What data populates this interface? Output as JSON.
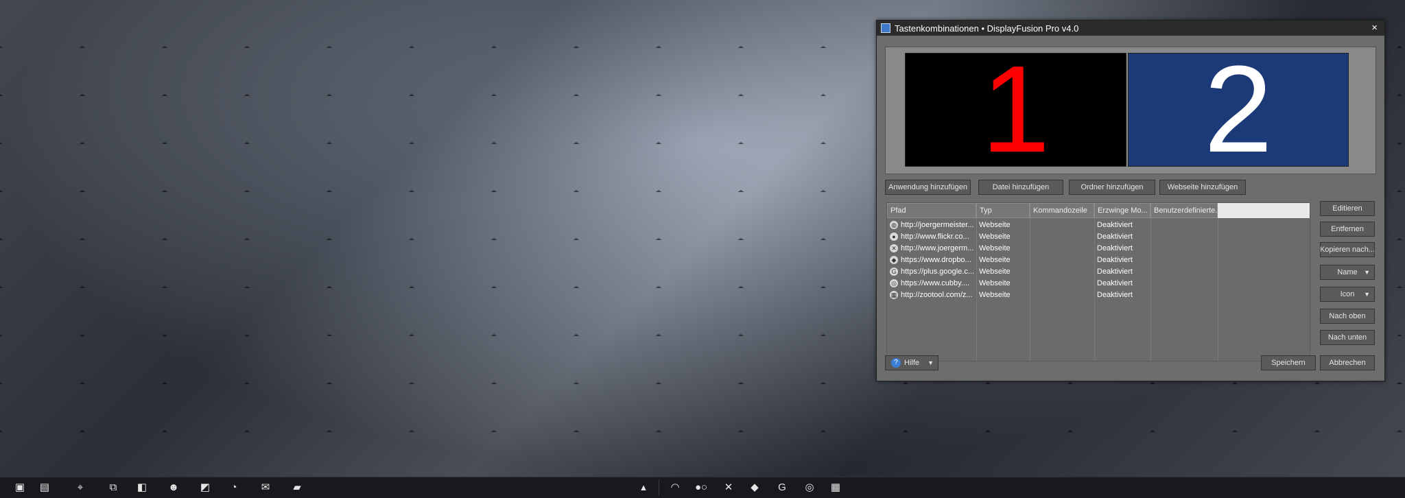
{
  "window": {
    "title": "Tastenkombinationen • DisplayFusion Pro v4.0",
    "close": "×"
  },
  "monitors": [
    {
      "label": "1",
      "color": "#ff0000",
      "background": "#000000"
    },
    {
      "label": "2",
      "color": "#ffffff",
      "background": "#1c3a78"
    }
  ],
  "add_buttons": [
    "Anwendung hinzufügen",
    "Datei hinzufügen",
    "Ordner hinzufügen",
    "Webseite hinzufügen"
  ],
  "columns": [
    "Pfad",
    "Typ",
    "Kommandozeile",
    "Erzwinge Mo...",
    "Benutzerdefinierte..."
  ],
  "rows": [
    {
      "icon": "globe-icon",
      "glyph": "◍",
      "path": "http://joergermeister...",
      "type": "Webseite",
      "force": "Deaktiviert"
    },
    {
      "icon": "flickr-icon",
      "glyph": "●",
      "path": "http://www.flickr.co...",
      "type": "Webseite",
      "force": "Deaktiviert"
    },
    {
      "icon": "tools-icon",
      "glyph": "✕",
      "path": "http://www.joergerm...",
      "type": "Webseite",
      "force": "Deaktiviert"
    },
    {
      "icon": "dropbox-icon",
      "glyph": "◆",
      "path": "https://www.dropbo...",
      "type": "Webseite",
      "force": "Deaktiviert"
    },
    {
      "icon": "google-plus-icon",
      "glyph": "G",
      "path": "https://plus.google.c...",
      "type": "Webseite",
      "force": "Deaktiviert"
    },
    {
      "icon": "cubby-icon",
      "glyph": "◎",
      "path": "https://www.cubby....",
      "type": "Webseite",
      "force": "Deaktiviert"
    },
    {
      "icon": "zootool-icon",
      "glyph": "▦",
      "path": "http://zootool.com/z...",
      "type": "Webseite",
      "force": "Deaktiviert"
    }
  ],
  "side_buttons": {
    "edit": "Editieren",
    "remove": "Entfernen",
    "copy": "Kopieren nach...",
    "name": "Name",
    "icon": "Icon",
    "up": "Nach oben",
    "down": "Nach unten"
  },
  "help": {
    "icon": "?",
    "label": "Hilfe"
  },
  "footer": {
    "save": "Speichern",
    "cancel": "Abbrechen"
  },
  "taskbar": {
    "left": [
      {
        "name": "taskbar-app-1-icon",
        "glyph": "▣"
      },
      {
        "name": "taskbar-app-2-icon",
        "glyph": "▤"
      },
      {
        "name": "taskbar-crosshair-icon",
        "glyph": "⌖"
      },
      {
        "name": "taskbar-windows-icon",
        "glyph": "⧉"
      },
      {
        "name": "taskbar-notes-icon",
        "glyph": "◧"
      },
      {
        "name": "taskbar-people-icon",
        "glyph": "☻"
      },
      {
        "name": "taskbar-displayfusion-icon",
        "glyph": "◩"
      },
      {
        "name": "taskbar-disc-icon",
        "glyph": "◔"
      },
      {
        "name": "taskbar-mail-icon",
        "glyph": "✉"
      },
      {
        "name": "taskbar-clapper-icon",
        "glyph": "▰"
      }
    ],
    "right": [
      {
        "name": "taskbar-expand-icon",
        "glyph": "▴"
      },
      {
        "name": "taskbar-wifi-icon",
        "glyph": "◠"
      },
      {
        "name": "taskbar-flickr-icon",
        "glyph": "●○"
      },
      {
        "name": "taskbar-tools-icon",
        "glyph": "✕"
      },
      {
        "name": "taskbar-dropbox-icon",
        "glyph": "◆"
      },
      {
        "name": "taskbar-google-icon",
        "glyph": "G"
      },
      {
        "name": "taskbar-cubby-icon",
        "glyph": "◎"
      },
      {
        "name": "taskbar-grid-icon",
        "glyph": "▦"
      }
    ]
  }
}
